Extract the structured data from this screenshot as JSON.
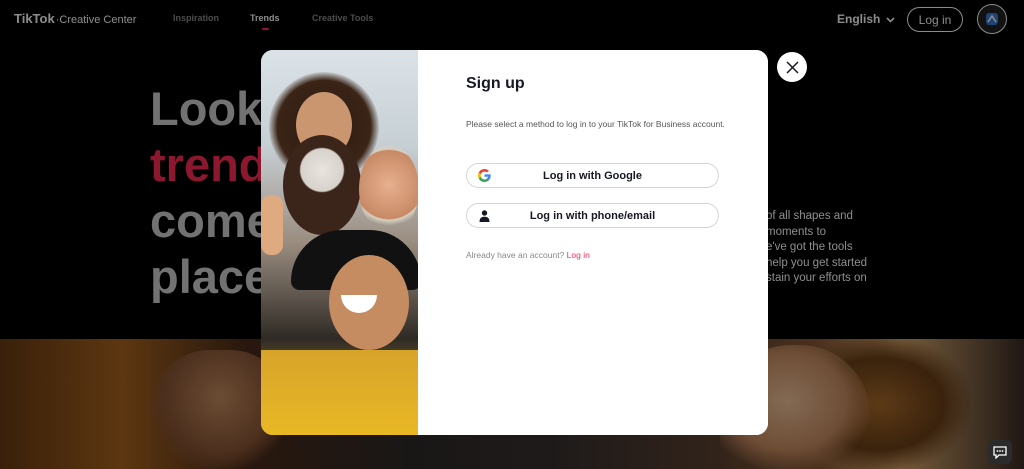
{
  "header": {
    "logo_brand": "TikTok",
    "logo_sub": "Creative Center",
    "nav": [
      "Inspiration",
      "Trends",
      "Creative Tools"
    ],
    "language": "English",
    "login": "Log in"
  },
  "hero": {
    "lines": [
      "Look",
      "trend",
      "come",
      "place"
    ],
    "paragraph": [
      "of all shapes and",
      "moments to",
      "e've got the tools",
      "help you get started",
      "stain your efforts on"
    ]
  },
  "modal": {
    "title": "Sign up",
    "description": "Please select a method to log in to your TikTok for Business account.",
    "google_button": "Log in with Google",
    "phone_button": "Log in with phone/email",
    "footer_text": "Already have an account?",
    "footer_link": "Log in"
  },
  "colors": {
    "accent": "#fe2c55",
    "text_dark": "#161823"
  },
  "icons": [
    "chevron-down-icon",
    "avatar-icon",
    "close-icon",
    "google-icon",
    "person-icon",
    "chat-icon"
  ]
}
